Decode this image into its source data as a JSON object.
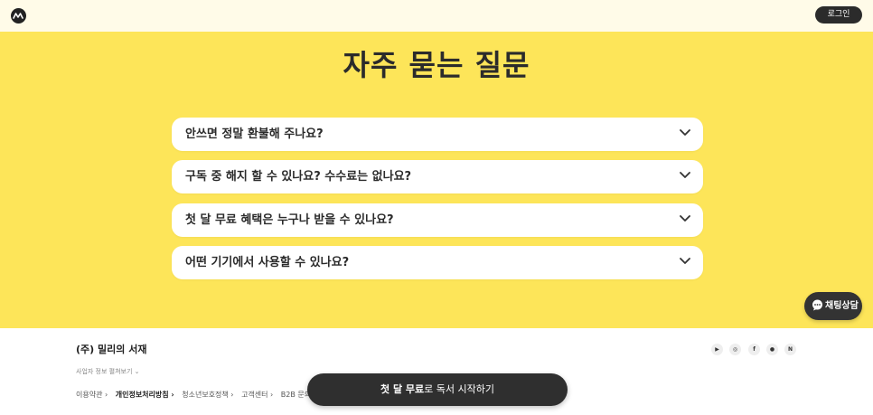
{
  "header": {
    "logo_icon": "millie-logo-icon",
    "login_label": "로그인"
  },
  "faq": {
    "title": "자주 묻는 질문",
    "items": [
      {
        "question": "안쓰면 정말 환불해 주나요?"
      },
      {
        "question": "구독 중 해지 할 수 있나요? 수수료는 없나요?"
      },
      {
        "question": "첫 달 무료 혜택은 누구나 받을 수 있나요?"
      },
      {
        "question": "어떤 기기에서 사용할 수 있나요?"
      }
    ],
    "chevron_icon": "chevron-down-icon"
  },
  "chat": {
    "icon": "chat-bubble-icon",
    "label": "채팅상담"
  },
  "footer": {
    "company": "(주) 밀리의 서재",
    "bizinfo": "사업자 정보 펼쳐보기 ⌄",
    "social_icons": [
      "youtube-icon",
      "instagram-icon",
      "facebook-icon",
      "kakao-icon",
      "naver-icon"
    ],
    "links": [
      {
        "label": "이용약관 ›"
      },
      {
        "label": "개인정보처리방침 ›"
      },
      {
        "label": "청소년보호정책 ›"
      },
      {
        "label": "고객센터 ›"
      },
      {
        "label": "B2B 문의 ›"
      }
    ]
  },
  "cta": {
    "bold": "첫 달 무료",
    "rest": "로 독서 시작하기"
  },
  "colors": {
    "accent_yellow": "#fde559",
    "header_bg": "#fffbe8",
    "dark": "#2b2b2b"
  }
}
